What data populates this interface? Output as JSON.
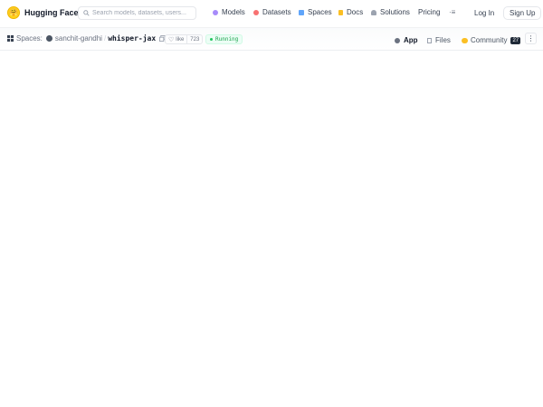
{
  "brand": {
    "name": "Hugging Face",
    "logo_glyph": "🤗"
  },
  "search": {
    "placeholder": "Search models, datasets, users..."
  },
  "nav": {
    "items": [
      {
        "label": "Models",
        "icon": "models-icon"
      },
      {
        "label": "Datasets",
        "icon": "datasets-icon"
      },
      {
        "label": "Spaces",
        "icon": "spaces-icon"
      },
      {
        "label": "Docs",
        "icon": "docs-icon"
      },
      {
        "label": "Solutions",
        "icon": "solutions-icon"
      },
      {
        "label": "Pricing"
      }
    ],
    "more_glyph": "·≡"
  },
  "auth": {
    "login": "Log In",
    "signup": "Sign Up"
  },
  "space": {
    "section": "Spaces:",
    "owner": "sanchit-gandhi",
    "separator": "/",
    "name": "whisper-jax",
    "like_label": "like",
    "like_count": "723",
    "status": "Running"
  },
  "tabs": [
    {
      "label": "App",
      "active": true
    },
    {
      "label": "Files"
    },
    {
      "label": "Community",
      "badge": "27"
    }
  ],
  "more_menu_glyph": "⋮",
  "colors": {
    "accent_yellow": "#ffd21e",
    "status_green": "#22c55e",
    "text_dark": "#111827"
  }
}
